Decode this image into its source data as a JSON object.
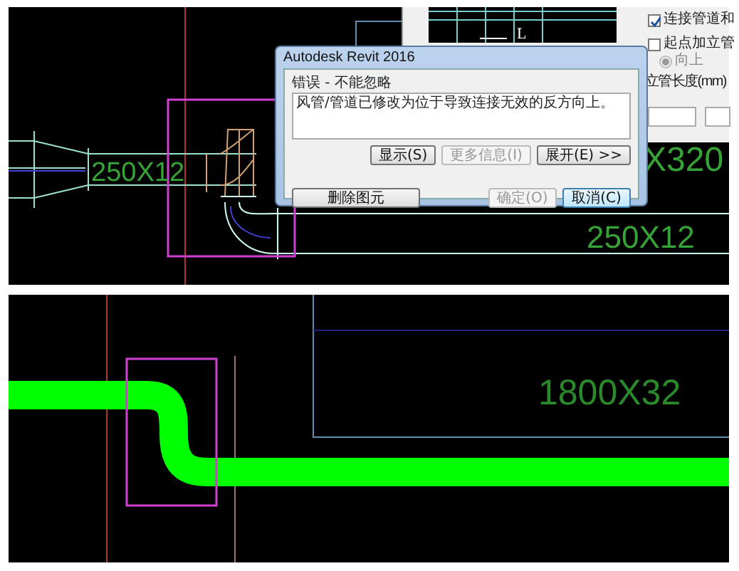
{
  "cad_top": {
    "labels": [
      {
        "text": "250X12"
      },
      {
        "text": "X320"
      },
      {
        "text": "250X12"
      }
    ],
    "marker": "L"
  },
  "properties_panel": {
    "connect_checkbox": {
      "label": "连接管道和",
      "checked": true
    },
    "riser_checkbox": {
      "label": "起点加立管",
      "checked": false
    },
    "up_radio": {
      "label": "向上",
      "selected": true,
      "disabled": true
    },
    "riser_length_label": "立管长度(mm)"
  },
  "dialog": {
    "title": "Autodesk Revit 2016",
    "group_title": "错误 - 不能忽略",
    "message": "风管/管道已修改为位于导致连接无效的反方向上。",
    "buttons": [
      {
        "label": "显示(S)",
        "disabled": false
      },
      {
        "label": "更多信息(I)",
        "disabled": true
      },
      {
        "label": "展开(E) >>",
        "disabled": false
      }
    ],
    "footer_buttons": [
      {
        "label": "删除图元",
        "disabled": false,
        "focused": false
      },
      {
        "label": "确定(O)",
        "disabled": true,
        "focused": false
      },
      {
        "label": "取消(C)",
        "disabled": false,
        "focused": true
      }
    ]
  },
  "cad_bottom": {
    "labels": [
      {
        "text": "1800X32"
      }
    ]
  }
}
